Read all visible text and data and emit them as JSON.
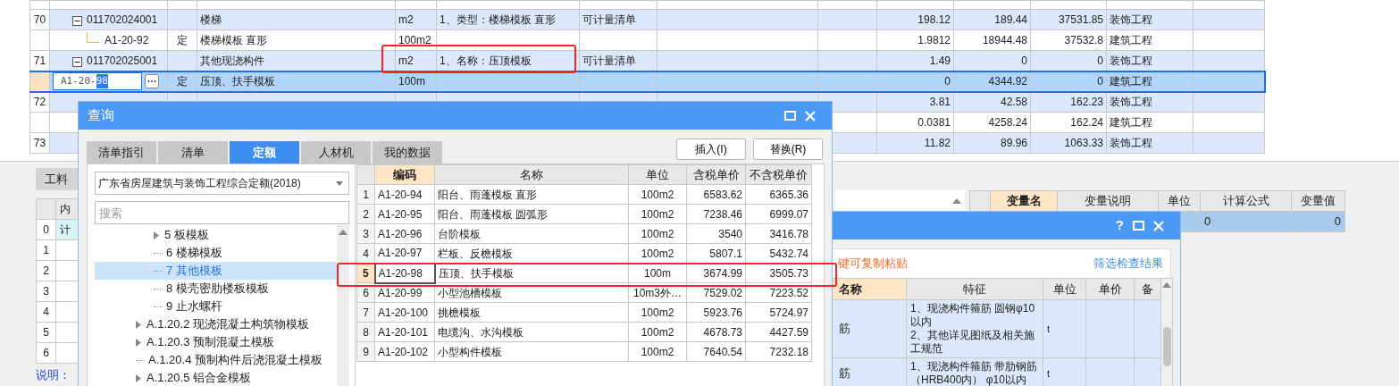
{
  "main_table": {
    "rows": [
      {
        "number": "70",
        "kind": "bill",
        "expanded": true,
        "code": "011702024001",
        "name": "楼梯",
        "unit": "m2",
        "feature": "1、类型：楼梯模板 直形",
        "category": "可计量清单",
        "quantity": "198.12",
        "unit_price": "189.44",
        "total": "37531.85",
        "profession": "装饰工程",
        "selected": false
      },
      {
        "kind": "quota",
        "code": "A1-20-92",
        "type": "定",
        "name": "楼梯模板 直形",
        "unit": "100m2",
        "quantity": "1.9812",
        "unit_price": "18944.48",
        "total": "37532.8",
        "profession": "建筑工程",
        "selected": false
      },
      {
        "number": "71",
        "kind": "bill",
        "expanded": true,
        "code": "011702025001",
        "name": "其他现浇构件",
        "unit": "m2",
        "feature": "1、名称：压顶模板",
        "category": "可计量清单",
        "quantity": "1.49",
        "unit_price": "0",
        "total": "0",
        "profession": "装饰工程",
        "selected": false
      },
      {
        "kind": "quota",
        "code_edit": {
          "text": "A1-20-",
          "selection": "98"
        },
        "type": "定",
        "name": "压顶、扶手模板",
        "unit": "100m",
        "quantity": "0",
        "unit_price": "4344.92",
        "total": "0",
        "profession": "建筑工程",
        "selected": true
      },
      {
        "number": "72",
        "kind": "bill",
        "quantity": "3.81",
        "unit_price": "42.58",
        "total": "162.23",
        "profession": "装饰工程",
        "selected": false
      },
      {
        "kind": "quota",
        "quantity": "0.0381",
        "unit_price": "4258.24",
        "total": "162.24",
        "profession": "建筑工程",
        "selected": false
      },
      {
        "number": "73",
        "kind": "bill",
        "quantity": "11.82",
        "unit_price": "89.96",
        "total": "1063.33",
        "profession": "装饰工程",
        "selected": false
      }
    ]
  },
  "bottom_panel": {
    "tab": "工料",
    "grid": {
      "header": "内",
      "rows": [
        {
          "number": "0",
          "cell": "计"
        },
        {
          "number": "1"
        },
        {
          "number": "2"
        },
        {
          "number": "3"
        },
        {
          "number": "4"
        },
        {
          "number": "5"
        },
        {
          "number": "6"
        }
      ]
    },
    "note": "说明：",
    "variables": {
      "columns": [
        {
          "label": "变量名",
          "highlighted": true
        },
        {
          "label": "变量说明",
          "highlighted": false
        },
        {
          "label": "单位",
          "highlighted": false
        },
        {
          "label": "计算公式",
          "highlighted": false
        },
        {
          "label": "变量值",
          "highlighted": false
        }
      ],
      "rows": [
        {
          "formula": "0",
          "value": "0",
          "selected": true
        }
      ]
    }
  },
  "check_dialog": {
    "help": "?",
    "hint": "键可复制粘贴",
    "filter_link": "筛选检查结果",
    "columns": [
      {
        "label": "名称",
        "highlighted": true
      },
      {
        "label": "特征",
        "highlighted": false
      },
      {
        "label": "单位",
        "highlighted": false
      },
      {
        "label": "单价",
        "highlighted": false
      },
      {
        "label": "备",
        "highlighted": false
      }
    ],
    "rows": [
      {
        "name": "筋",
        "feature": [
          "1、现浇构件箍筋 圆钢φ10以内",
          "2、其他详见图纸及相关施工规范"
        ],
        "unit": "t"
      },
      {
        "name": "筋",
        "feature": [
          "1、现浇构件箍筋 带肋钢筋（HRB400内） φ10以内"
        ],
        "unit": "t"
      }
    ]
  },
  "query_dialog": {
    "title": "查询",
    "tabs": [
      {
        "label": "清单指引",
        "selected": false
      },
      {
        "label": "清单",
        "selected": false
      },
      {
        "label": "定额",
        "selected": true
      },
      {
        "label": "人材机",
        "selected": false
      },
      {
        "label": "我的数据",
        "selected": false
      }
    ],
    "buttons": [
      "插入(I)",
      "替换(R)"
    ],
    "library": "广东省房屋建筑与装饰工程综合定额(2018)",
    "search": {
      "placeholder": "搜索"
    },
    "tree": [
      {
        "children": [
          {
            "label": "5 板模板",
            "expandable": true,
            "selected": false
          },
          {
            "label": "6 楼梯模板",
            "expandable": false,
            "selected": false
          },
          {
            "label": "7 其他模板",
            "expandable": false,
            "selected": true
          },
          {
            "label": "8 模壳密肋楼板模板",
            "expandable": false,
            "selected": false
          },
          {
            "label": "9 止水螺杆",
            "expandable": false,
            "selected": false
          }
        ]
      },
      {
        "label": "A.1.20.2 现浇混凝土构筑物模板",
        "expandable": true,
        "selected": false
      },
      {
        "label": "A.1.20.3 预制混凝土模板",
        "expandable": true,
        "selected": false
      },
      {
        "label": "A.1.20.4 预制构件后浇混凝土模板",
        "expandable": false,
        "selected": false
      },
      {
        "label": "A.1.20.5 铝合金模板",
        "expandable": true,
        "selected": false
      }
    ],
    "table": {
      "columns": [
        {
          "label": "编码",
          "highlighted": true
        },
        {
          "label": "名称",
          "highlighted": false
        },
        {
          "label": "单位",
          "highlighted": false
        },
        {
          "label": "含税单价",
          "highlighted": false
        },
        {
          "label": "不含税单价",
          "highlighted": false
        }
      ],
      "rows": [
        {
          "number": "1",
          "code": "A1-20-94",
          "name": "阳台、雨蓬模板 直形",
          "unit": "100m2",
          "price_tax": "6583.62",
          "price_notax": "6365.36",
          "selected": false
        },
        {
          "number": "2",
          "code": "A1-20-95",
          "name": "阳台、雨蓬模板 圆弧形",
          "unit": "100m2",
          "price_tax": "7238.46",
          "price_notax": "6999.07",
          "selected": false
        },
        {
          "number": "3",
          "code": "A1-20-96",
          "name": "台阶模板",
          "unit": "100m2",
          "price_tax": "3540",
          "price_notax": "3416.78",
          "selected": false
        },
        {
          "number": "4",
          "code": "A1-20-97",
          "name": "栏板、反檐模板",
          "unit": "100m2",
          "price_tax": "5807.1",
          "price_notax": "5432.74",
          "selected": false
        },
        {
          "number": "5",
          "code": "A1-20-98",
          "name": "压顶、扶手模板",
          "unit": "100m",
          "price_tax": "3674.99",
          "price_notax": "3505.73",
          "selected": true
        },
        {
          "number": "6",
          "code": "A1-20-99",
          "name": "小型池槽模板",
          "unit": "10m3外…",
          "price_tax": "7529.02",
          "price_notax": "7223.52",
          "selected": false
        },
        {
          "number": "7",
          "code": "A1-20-100",
          "name": "挑檐模板",
          "unit": "100m2",
          "price_tax": "5923.76",
          "price_notax": "5724.97",
          "selected": false
        },
        {
          "number": "8",
          "code": "A1-20-101",
          "name": "电缆沟、水沟模板",
          "unit": "100m2",
          "price_tax": "4678.73",
          "price_notax": "4427.59",
          "selected": false
        },
        {
          "number": "9",
          "code": "A1-20-102",
          "name": "小型构件模板",
          "unit": "100m2",
          "price_tax": "7640.54",
          "price_notax": "7232.18",
          "selected": false
        }
      ]
    }
  }
}
